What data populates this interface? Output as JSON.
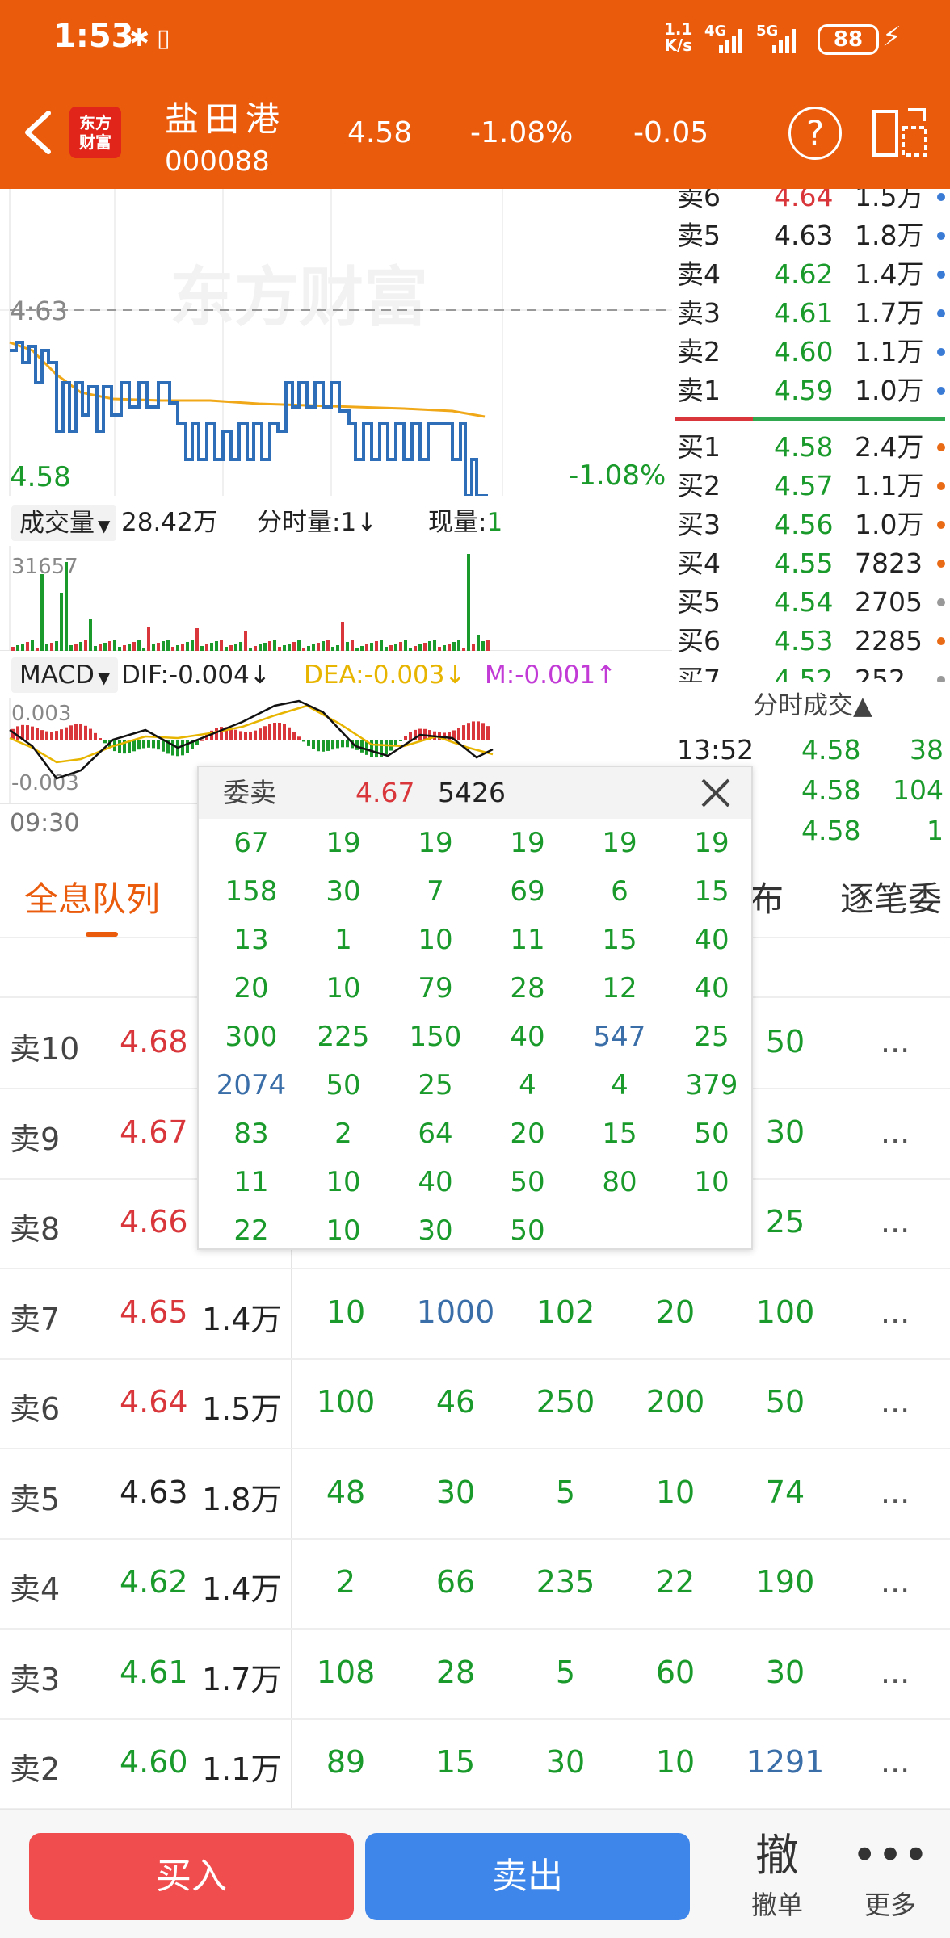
{
  "status": {
    "time": "1:53",
    "net_speed_top": "1.1",
    "net_speed_bottom": "K/s",
    "sig1": "4G",
    "sig2": "5G",
    "battery": "88"
  },
  "header": {
    "logo_top": "东方",
    "logo_bottom": "财富",
    "stock_name": "盐田港",
    "stock_code": "000088",
    "price": "4.58",
    "change_pct": "-1.08%",
    "change": "-0.05"
  },
  "chart": {
    "watermark": "东方财富",
    "price_high": "4:63",
    "price_low": "4.58",
    "change_pct": "-1.08%",
    "vol_select": "成交量",
    "vol_total": "28.42万",
    "vol_tick": "分时量:1↓",
    "vol_now_label": "现量:",
    "vol_now_value": "1",
    "vol_max": "31657",
    "macd_select": "MACD",
    "dif": "DIF:-0.004↓",
    "dea": "DEA:-0.003↓",
    "m": "M:-0.001↑",
    "macd_max": "0.003",
    "macd_min": "-0.003",
    "time_start": "09:30",
    "colors": {
      "price": "#2e6db8",
      "avg": "#f0a818",
      "up": "#d8363a",
      "down": "#199a2a"
    }
  },
  "order_book": {
    "asks": [
      {
        "label": "卖6",
        "price": "4.64",
        "vol": "1.5万",
        "price_color": "red"
      },
      {
        "label": "卖5",
        "price": "4.63",
        "vol": "1.8万",
        "price_color": "black"
      },
      {
        "label": "卖4",
        "price": "4.62",
        "vol": "1.4万",
        "price_color": "green"
      },
      {
        "label": "卖3",
        "price": "4.61",
        "vol": "1.7万",
        "price_color": "green"
      },
      {
        "label": "卖2",
        "price": "4.60",
        "vol": "1.1万",
        "price_color": "green"
      },
      {
        "label": "卖1",
        "price": "4.59",
        "vol": "1.0万",
        "price_color": "green"
      }
    ],
    "bids": [
      {
        "label": "买1",
        "price": "4.58",
        "vol": "2.4万",
        "dot": "orange"
      },
      {
        "label": "买2",
        "price": "4.57",
        "vol": "1.1万",
        "dot": "orange"
      },
      {
        "label": "买3",
        "price": "4.56",
        "vol": "1.0万",
        "dot": "orange"
      },
      {
        "label": "买4",
        "price": "4.55",
        "vol": "7823",
        "dot": "orange"
      },
      {
        "label": "买5",
        "price": "4.54",
        "vol": "2705",
        "dot": "grey"
      },
      {
        "label": "买6",
        "price": "4.53",
        "vol": "2285",
        "dot": "orange"
      },
      {
        "label": "买7",
        "price": "4.52",
        "vol": "252",
        "dot": "grey"
      }
    ]
  },
  "trades": {
    "title": "分时成交▲",
    "rows": [
      {
        "time": "13:52",
        "price": "4.58",
        "vol": "38"
      },
      {
        "time": "",
        "price": "4.58",
        "vol": "104"
      },
      {
        "time": "",
        "price": "4.58",
        "vol": "1"
      }
    ]
  },
  "tabs": {
    "queue": "全息队列",
    "dist": "布",
    "tick": "逐笔委"
  },
  "queue": [
    {
      "label": "卖10",
      "price": "4.68",
      "color": "red",
      "vol": "",
      "cells": [
        "",
        "",
        "",
        "",
        "50"
      ]
    },
    {
      "label": "卖9",
      "price": "4.67",
      "color": "red",
      "vol": "",
      "cells": [
        "",
        "",
        "",
        "",
        "30"
      ]
    },
    {
      "label": "卖8",
      "price": "4.66",
      "color": "red",
      "vol": "",
      "cells": [
        "",
        "",
        "",
        "",
        "25"
      ]
    },
    {
      "label": "卖7",
      "price": "4.65",
      "color": "red",
      "vol": "1.4万",
      "cells": [
        "10",
        "1000",
        "102",
        "20",
        "100"
      ]
    },
    {
      "label": "卖6",
      "price": "4.64",
      "color": "red",
      "vol": "1.5万",
      "cells": [
        "100",
        "46",
        "250",
        "200",
        "50"
      ]
    },
    {
      "label": "卖5",
      "price": "4.63",
      "color": "black",
      "vol": "1.8万",
      "cells": [
        "48",
        "30",
        "5",
        "10",
        "74"
      ]
    },
    {
      "label": "卖4",
      "price": "4.62",
      "color": "green",
      "vol": "1.4万",
      "cells": [
        "2",
        "66",
        "235",
        "22",
        "190"
      ]
    },
    {
      "label": "卖3",
      "price": "4.61",
      "color": "green",
      "vol": "1.7万",
      "cells": [
        "108",
        "28",
        "5",
        "60",
        "30"
      ]
    },
    {
      "label": "卖2",
      "price": "4.60",
      "color": "green",
      "vol": "1.1万",
      "cells": [
        "89",
        "15",
        "30",
        "10",
        "1291"
      ]
    }
  ],
  "queue_more": "...",
  "popup": {
    "title": "委卖",
    "price": "4.67",
    "vol": "5426",
    "rows": [
      [
        "67",
        "19",
        "19",
        "19",
        "19",
        "19"
      ],
      [
        "158",
        "30",
        "7",
        "69",
        "6",
        "15"
      ],
      [
        "13",
        "1",
        "10",
        "11",
        "15",
        "40"
      ],
      [
        "20",
        "10",
        "79",
        "28",
        "12",
        "40"
      ],
      [
        "300",
        "225",
        "150",
        "40",
        "547",
        "25"
      ],
      [
        "2074",
        "50",
        "25",
        "4",
        "4",
        "379"
      ],
      [
        "83",
        "2",
        "64",
        "20",
        "15",
        "50"
      ],
      [
        "11",
        "10",
        "40",
        "50",
        "80",
        "10"
      ],
      [
        "22",
        "10",
        "30",
        "50"
      ]
    ],
    "highlight": [
      "547",
      "2074"
    ]
  },
  "bottom": {
    "buy": "买入",
    "sell": "卖出",
    "cancel_glyph": "撤",
    "cancel": "撤单",
    "more_glyph": "•••",
    "more": "更多"
  }
}
